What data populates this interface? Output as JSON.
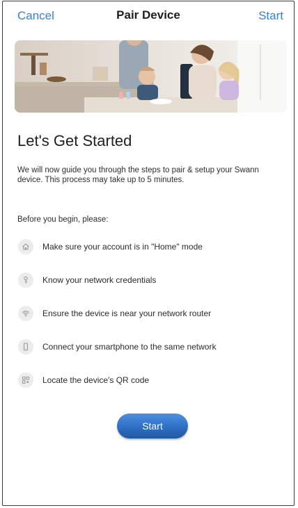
{
  "nav": {
    "cancel_label": "Cancel",
    "title": "Pair Device",
    "start_label": "Start"
  },
  "hero": {
    "image": "family-kitchen-photo"
  },
  "heading": "Let's Get Started",
  "intro": "We will now guide you through the steps to pair & setup your Swann device. This process may take up to 5 minutes.",
  "before_label": "Before you begin, please:",
  "checklist": [
    {
      "icon": "home-icon",
      "text": "Make sure your account is in \"Home\" mode"
    },
    {
      "icon": "key-icon",
      "text": "Know your network credentials"
    },
    {
      "icon": "wifi-icon",
      "text": "Ensure the device is near your network router"
    },
    {
      "icon": "smartphone-icon",
      "text": "Connect your smartphone to the same network"
    },
    {
      "icon": "qr-code-icon",
      "text": "Locate the device's QR code"
    }
  ],
  "start_button_label": "Start",
  "colors": {
    "accent": "#3b7fd1",
    "button": "#2f6fc4"
  }
}
